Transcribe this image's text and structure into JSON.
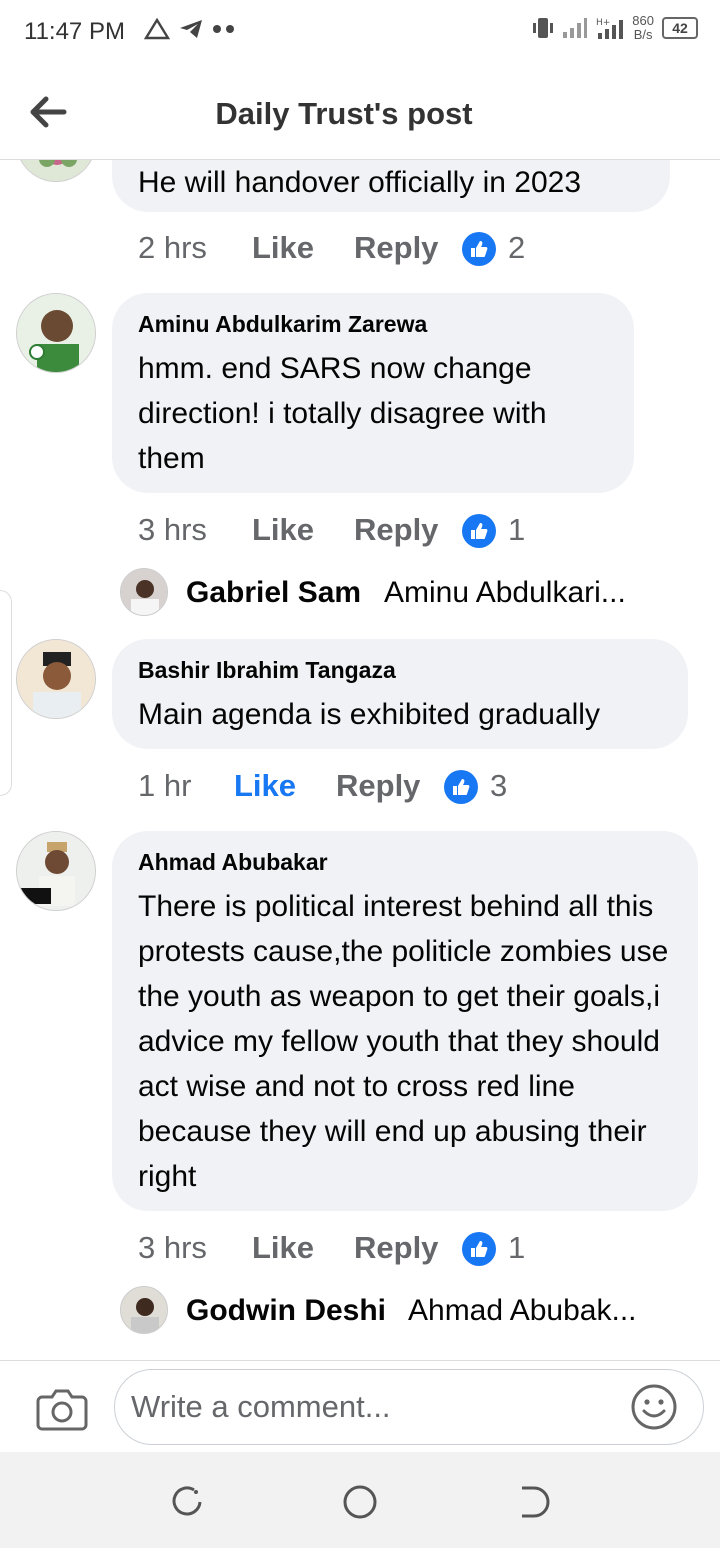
{
  "status": {
    "time": "11:47 PM",
    "net_speed_value": "860",
    "net_speed_unit": "B/s",
    "battery": "42"
  },
  "header": {
    "title": "Daily Trust's post"
  },
  "comments": [
    {
      "text": "He will handover officially in 2023",
      "time": "2 hrs",
      "like_label": "Like",
      "reply_label": "Reply",
      "reactions": "2"
    },
    {
      "author": "Aminu Abdulkarim Zarewa",
      "text": "hmm. end SARS now change direction! i totally disagree with them",
      "time": "3 hrs",
      "like_label": "Like",
      "reply_label": "Reply",
      "reactions": "1",
      "reply_preview": {
        "author": "Gabriel Sam",
        "snippet": "Aminu Abdulkari..."
      }
    },
    {
      "author": "Bashir Ibrahim Tangaza",
      "text": "Main agenda is exhibited gradually",
      "time": "1 hr",
      "like_label": "Like",
      "reply_label": "Reply",
      "reactions": "3",
      "liked": true
    },
    {
      "author": "Ahmad Abubakar",
      "text": "There is political interest behind all this protests cause,the politicle zombies use the youth as weapon to get their goals,i advice my fellow youth that they should act wise and not to cross red line because they will end up abusing  their right",
      "time": "3 hrs",
      "like_label": "Like",
      "reply_label": "Reply",
      "reactions": "1",
      "reply_preview": {
        "author": "Godwin Deshi",
        "snippet": "Ahmad Abubak..."
      }
    }
  ],
  "composer": {
    "placeholder": "Write a comment..."
  },
  "colors": {
    "accent": "#1877f2",
    "bubble": "#f0f2f5",
    "secondary_text": "#65676b"
  },
  "icons": [
    "back-arrow-icon",
    "camera-icon",
    "emoji-icon",
    "like-thumb-icon",
    "recent-apps-icon",
    "home-icon",
    "back-nav-icon"
  ]
}
